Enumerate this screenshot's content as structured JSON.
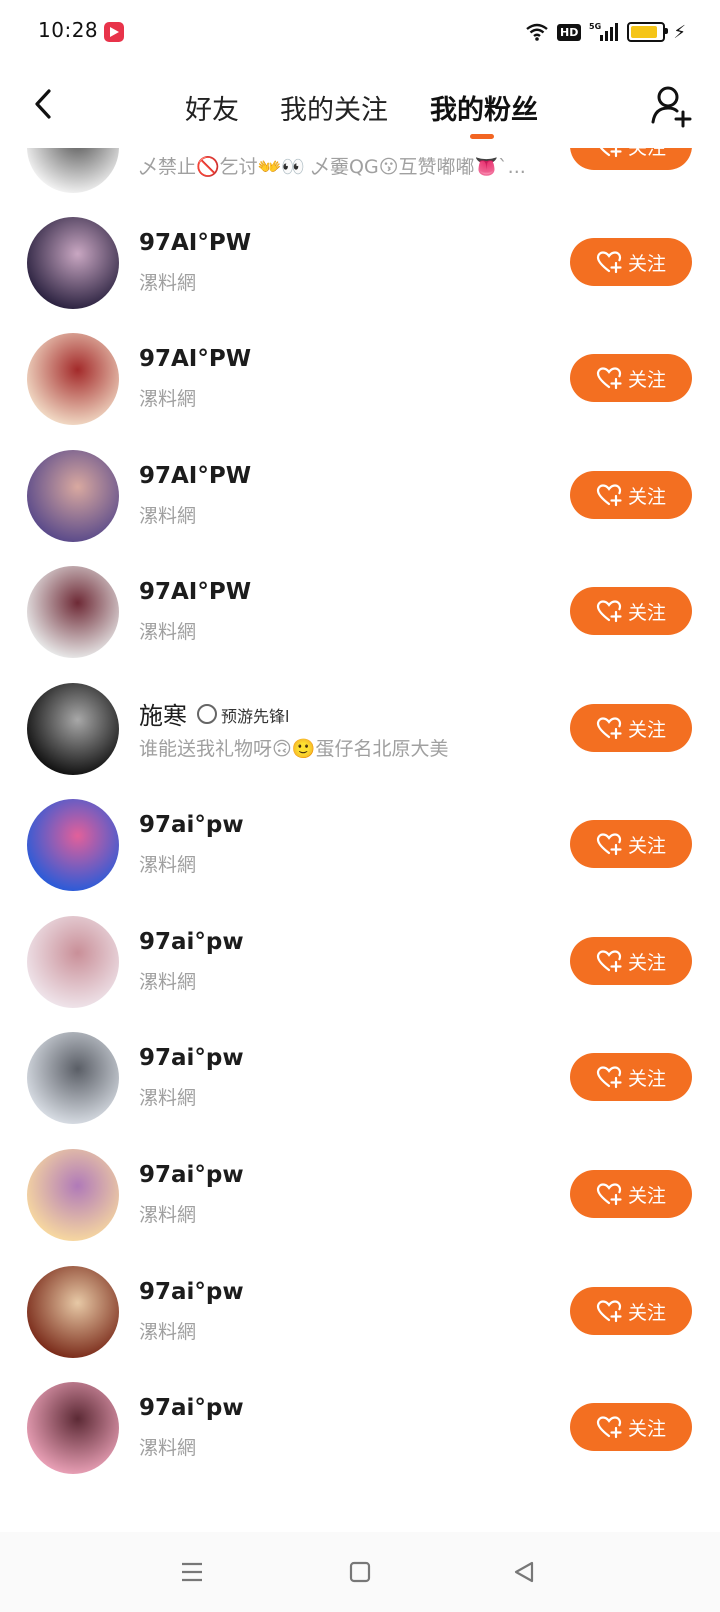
{
  "status_bar": {
    "time": "10:28",
    "hd_label": "HD",
    "network_label": "5G"
  },
  "tabs": [
    {
      "label": "好友",
      "active": false
    },
    {
      "label": "我的关注",
      "active": false
    },
    {
      "label": "我的粉丝",
      "active": true
    }
  ],
  "colors": {
    "accent": "#f36f21",
    "tab_indicator": "#f26522"
  },
  "follow_label": "关注",
  "list": [
    {
      "name": "",
      "desc": "乄禁止🚫乞讨👐👀 乄嫑QG😗互赞嘟嘟👅`...",
      "avatar_colors": [
        "#f2f2f2",
        "#555555"
      ]
    },
    {
      "name": "97AI°PW",
      "desc": "漯料網",
      "avatar_colors": [
        "#2b2240",
        "#c9a7c2"
      ]
    },
    {
      "name": "97AI°PW",
      "desc": "漯料網",
      "avatar_colors": [
        "#f1d9c4",
        "#a32a2a"
      ]
    },
    {
      "name": "97AI°PW",
      "desc": "漯料網",
      "avatar_colors": [
        "#5a4a8a",
        "#d9a9a0"
      ]
    },
    {
      "name": "97AI°PW",
      "desc": "漯料網",
      "avatar_colors": [
        "#e8e8e8",
        "#6e2a36"
      ]
    },
    {
      "name": "施寒",
      "tag": "预游先锋l",
      "desc": "谁能送我礼物呀🙃🙂蛋仔名北原大美",
      "avatar_colors": [
        "#111111",
        "#a8a8a8"
      ]
    },
    {
      "name": "97ai°pw",
      "desc": "漯料網",
      "avatar_colors": [
        "#2a5bd8",
        "#e2609a"
      ]
    },
    {
      "name": "97ai°pw",
      "desc": "漯料網",
      "avatar_colors": [
        "#efe4ea",
        "#c98f98"
      ]
    },
    {
      "name": "97ai°pw",
      "desc": "漯料網",
      "avatar_colors": [
        "#d7dce3",
        "#5a5e66"
      ]
    },
    {
      "name": "97ai°pw",
      "desc": "漯料網",
      "avatar_colors": [
        "#f7d8a0",
        "#b07ab8"
      ]
    },
    {
      "name": "97ai°pw",
      "desc": "漯料網",
      "avatar_colors": [
        "#7a2b1a",
        "#e7c9a6"
      ]
    },
    {
      "name": "97ai°pw",
      "desc": "漯料網",
      "avatar_colors": [
        "#e9a0b6",
        "#5c2a35"
      ]
    }
  ]
}
